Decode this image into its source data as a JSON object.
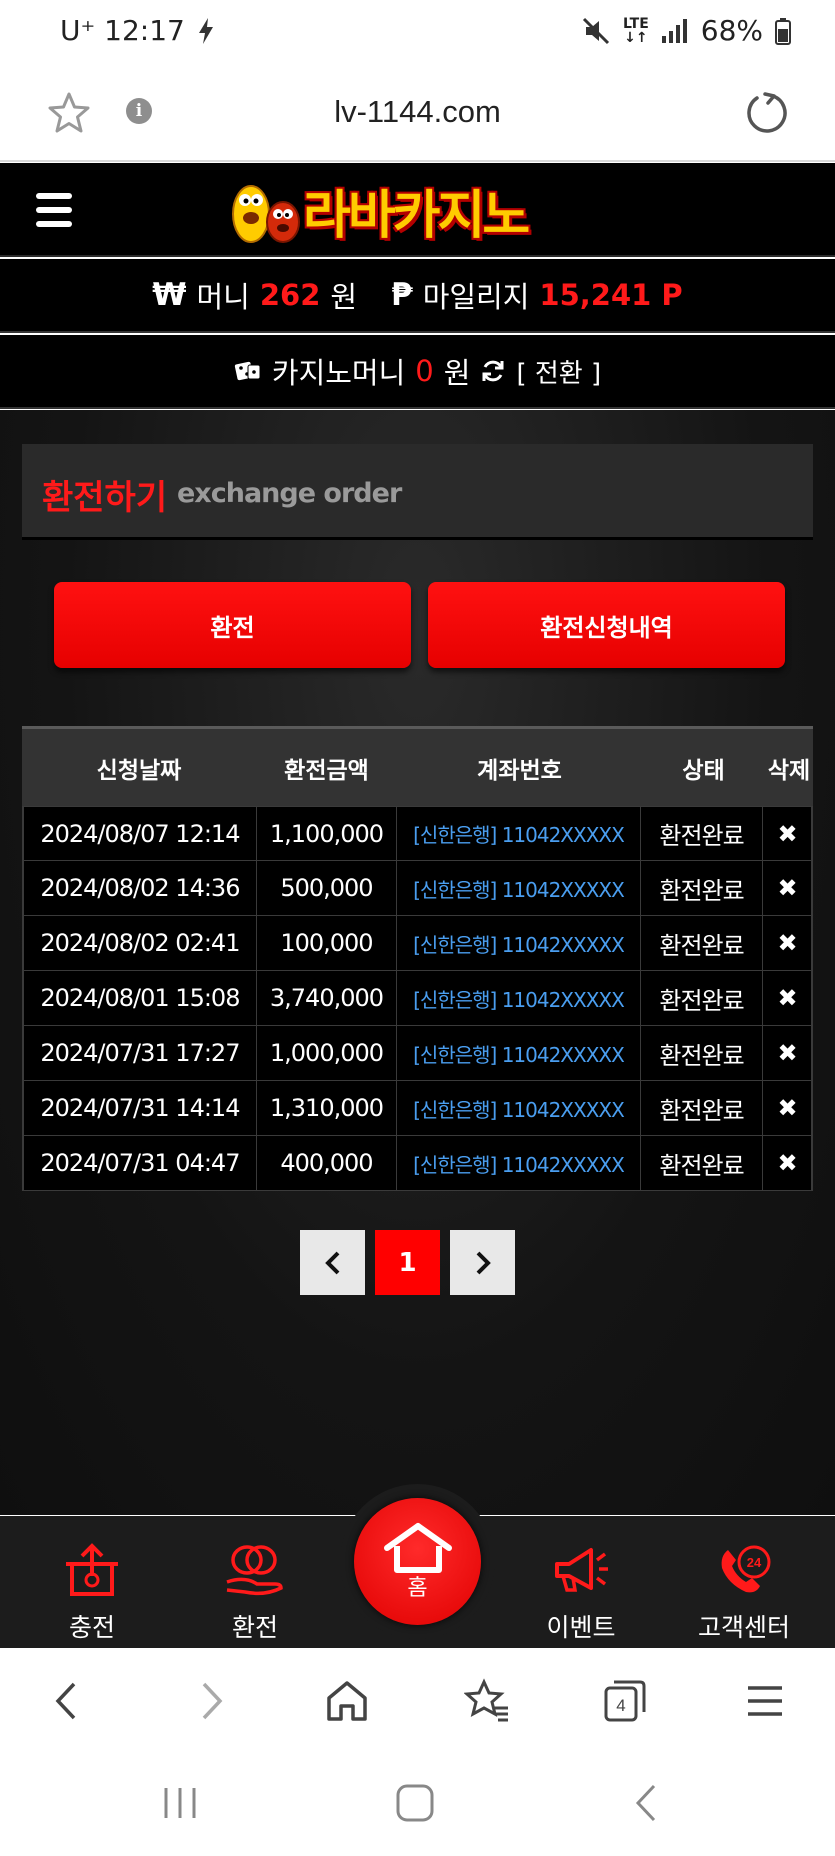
{
  "status_bar": {
    "carrier_time": "U⁺ 12:17",
    "network": "LTE",
    "battery": "68%"
  },
  "url_bar": {
    "url": "lv-1144.com"
  },
  "header": {
    "logo_text": "라바카지노"
  },
  "wallet": {
    "money_label": "머니",
    "money_value": "262",
    "money_unit": "원",
    "mileage_label": "마일리지",
    "mileage_value": "15,241 P",
    "casino_label": "카지노머니",
    "casino_value": "0",
    "casino_unit": "원",
    "convert_label": "[ 전환 ]"
  },
  "section": {
    "title_ko": "환전하기",
    "title_en": "exchange order"
  },
  "buttons": {
    "exchange": "환전",
    "history": "환전신청내역"
  },
  "table": {
    "headers": [
      "신청날짜",
      "환전금액",
      "계좌번호",
      "상태",
      "삭제"
    ],
    "rows": [
      {
        "date": "2024/08/07 12:14",
        "amount": "1,100,000",
        "account": "[신한은행] 11042XXXXX",
        "status": "환전완료"
      },
      {
        "date": "2024/08/02 14:36",
        "amount": "500,000",
        "account": "[신한은행] 11042XXXXX",
        "status": "환전완료"
      },
      {
        "date": "2024/08/02 02:41",
        "amount": "100,000",
        "account": "[신한은행] 11042XXXXX",
        "status": "환전완료"
      },
      {
        "date": "2024/08/01 15:08",
        "amount": "3,740,000",
        "account": "[신한은행] 11042XXXXX",
        "status": "환전완료"
      },
      {
        "date": "2024/07/31 17:27",
        "amount": "1,000,000",
        "account": "[신한은행] 11042XXXXX",
        "status": "환전완료"
      },
      {
        "date": "2024/07/31 14:14",
        "amount": "1,310,000",
        "account": "[신한은행] 11042XXXXX",
        "status": "환전완료"
      },
      {
        "date": "2024/07/31 04:47",
        "amount": "400,000",
        "account": "[신한은행] 11042XXXXX",
        "status": "환전완료"
      }
    ]
  },
  "pagination": {
    "current": "1"
  },
  "bottom_nav": {
    "charge": "충전",
    "exchange": "환전",
    "home": "홈",
    "event": "이벤트",
    "support": "고객센터",
    "support_badge": "24"
  },
  "browser_nav": {
    "tab_count": "4"
  },
  "colors": {
    "accent_red": "#ff0000",
    "account_blue": "#4a9ef0",
    "logo_yellow": "#ffcc00"
  }
}
